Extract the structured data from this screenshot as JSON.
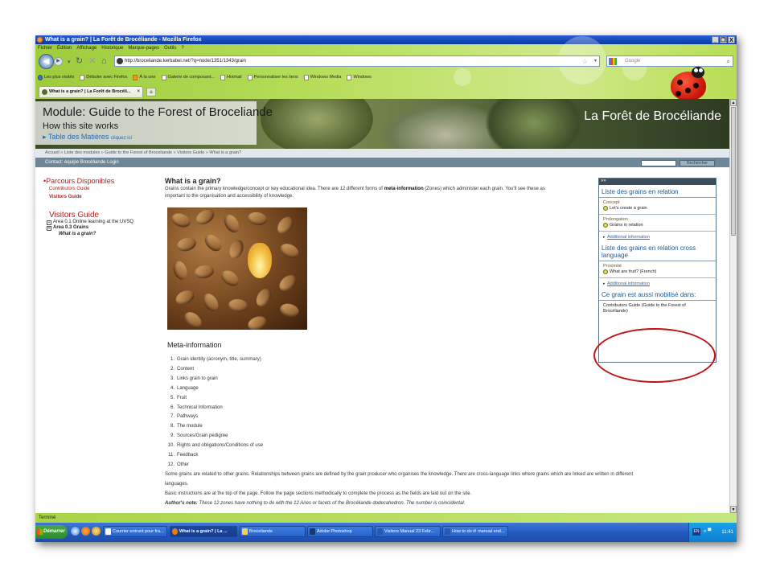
{
  "window": {
    "title": "What is a grain? | La Forêt de Brocéliande - Mozilla Firefox",
    "controls": [
      "_",
      "❐",
      "X"
    ]
  },
  "menu": [
    "Fichier",
    "Édition",
    "Affichage",
    "Historique",
    "Marque-pages",
    "Outils",
    "?"
  ],
  "navbar": {
    "url": "http://broceliande.kerbabel.net/?q=node/1351/1343/grain",
    "search_placeholder": "Google"
  },
  "bookmarks": [
    {
      "label": "Les plus visités",
      "icon": "ff"
    },
    {
      "label": "Débuter avec Firefox",
      "icon": "page"
    },
    {
      "label": "À la une",
      "icon": "rss"
    },
    {
      "label": "Galerie de composant...",
      "icon": "page"
    },
    {
      "label": "Hotmail",
      "icon": "page"
    },
    {
      "label": "Personnaliser les liens",
      "icon": "page"
    },
    {
      "label": "Windows Media",
      "icon": "page"
    },
    {
      "label": "Windows",
      "icon": "page"
    }
  ],
  "tab": {
    "label": "What is a grain? | La Forêt de Brocéli...",
    "close": "×",
    "new": "+"
  },
  "banner": {
    "module_title": "Module: Guide to the Forest of Broceliande",
    "how_works": "How this site works",
    "toc": "Table des Matières",
    "toc_hint": "cliquez ici",
    "site_title": "La Forêt de Brocéliande"
  },
  "breadcrumb": "Accueil » Liste des modules » Guide to the Forest of Broceliande » Visitors Guide » What is a grain?",
  "contact": "Contact: équipe Brocéliande   Login",
  "search_button": "Rechercher",
  "left_nav": {
    "heading": "Parcours Disponibles",
    "links": [
      "Contributors Guide",
      "Visitors Guide"
    ],
    "section": "Visitors Guide",
    "tree": [
      "Area 0.1 Online learning at the UVSQ",
      "Area 0.3 Grains"
    ],
    "current": "What is a grain?"
  },
  "main": {
    "title": "What is a grain?",
    "intro_1": "Grains contain the primary knowledge/concept or key educational idea. There are 12 different forms of ",
    "intro_bold": "meta-information",
    "intro_2": " (Zones) which administer each grain. You'll see these as",
    "intro_3": "important to the organisation and accessibility of knowledge.",
    "meta_title": "Meta-information",
    "meta_items": [
      "Grain identity (acronym, title, summary)",
      "Content",
      "Links grain to grain",
      "Language",
      "Fruit",
      "Technical Information",
      "Pathways",
      "The module",
      "Sources/Grain pedigree",
      "Rights and obligations/Conditions of use",
      "Feedback",
      "Other"
    ],
    "para_1": "Some grains are related to other grains. Relationships between grains are defined by the grain producer who organises the knowledge. There are cross-language links where grains which are linked are written in different",
    "para_2": "languages.",
    "para_3": "Basic instructions are at the top of the page. Follow the page sections methodically to complete the process as the fields are laid out on the site.",
    "author_label": "Author's note:",
    "author_text": " These 12 zones have nothing to do with the 12 Aires or facets of the Brocéliande dodecahedron. The number is coincidental."
  },
  "related": {
    "header": "»»",
    "title_1": "Liste des grains en relation",
    "concept_label": "Concept",
    "concept_item": "Let's create a grain",
    "prolong_label": "Prolongation",
    "prolong_item": "Grains in relation",
    "additional": "Additional information",
    "title_2": "Liste des grains en relation cross language",
    "proximite_label": "Proximité",
    "proximite_item": "What are fruit? (French)",
    "title_3": "Ce grain est aussi mobilisé dans:",
    "mobilise_text": "Contributors Guide (Guide to the Forest of Brocéliande)"
  },
  "status": "Terminé",
  "taskbar": {
    "start": "Démarrer",
    "tasks": [
      {
        "label": "Courrier entrant pour fra...",
        "active": false
      },
      {
        "label": "What is a grain? | La ...",
        "active": true
      },
      {
        "label": "Broceliande",
        "active": false
      },
      {
        "label": "Adobe Photoshop",
        "active": false
      },
      {
        "label": "Visitors Manual 23 Febr...",
        "active": false
      },
      {
        "label": "How to do it! manual end...",
        "active": false
      }
    ],
    "lang": "EN",
    "tray_icons": "« ▀",
    "clock": "11:41"
  },
  "colors": {
    "accent_red": "#b42020",
    "link_blue": "#2a6bb3",
    "chrome_green": "#b6dd5a",
    "annotation_circle": "#c01414"
  }
}
